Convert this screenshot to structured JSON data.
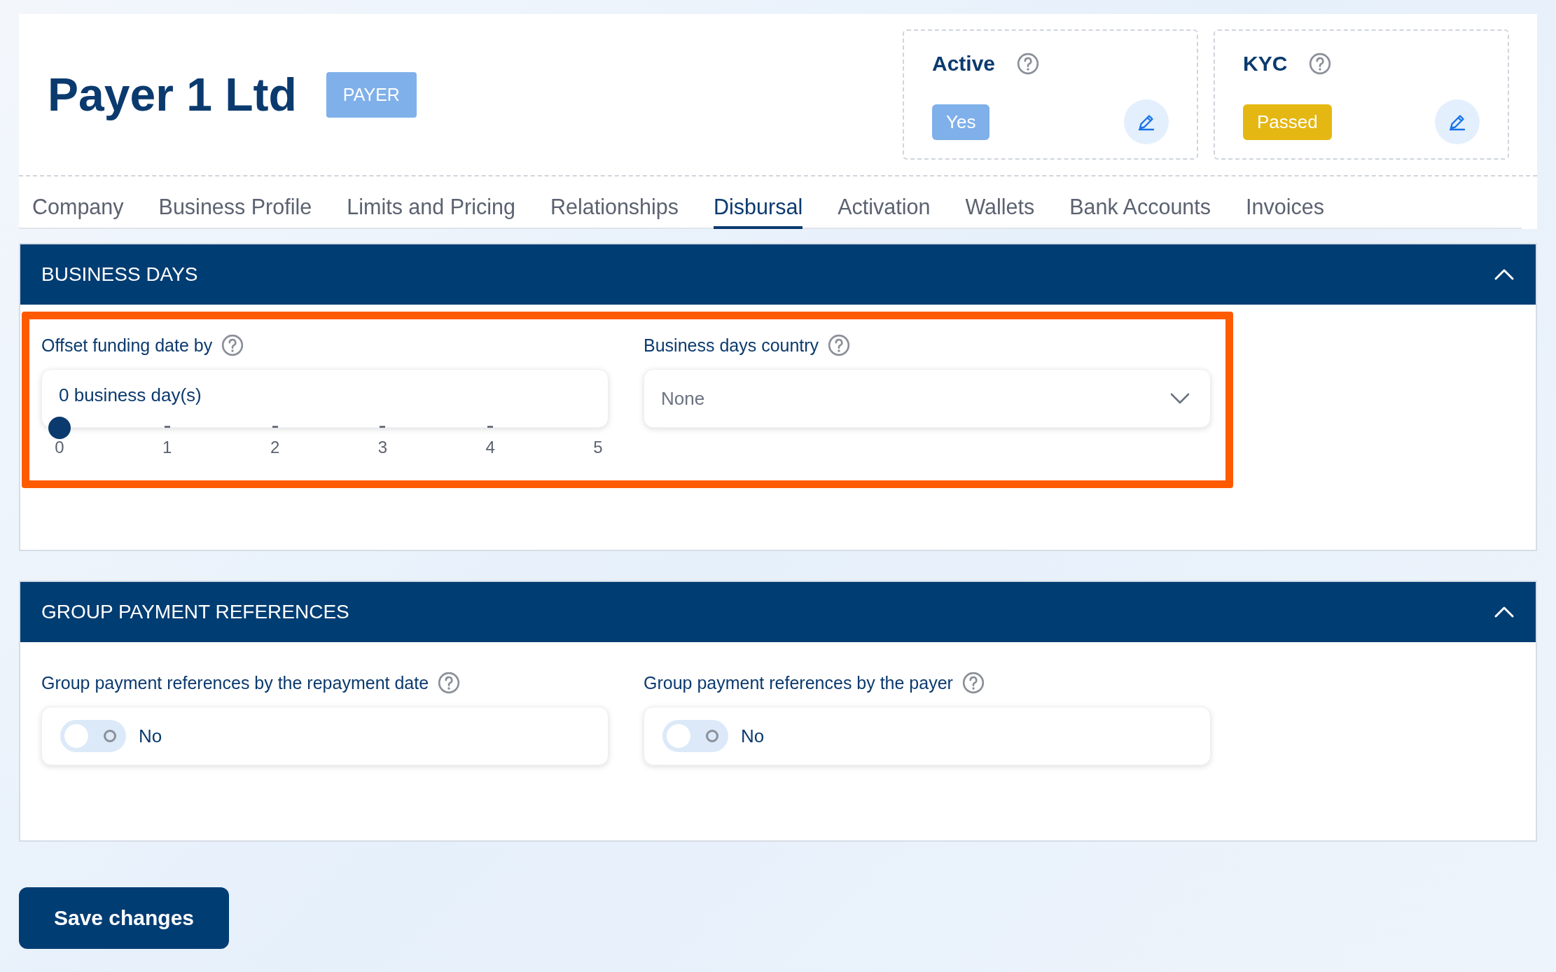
{
  "header": {
    "title": "Payer 1 Ltd",
    "badge": "PAYER",
    "status_cards": [
      {
        "label": "Active",
        "value": "Yes",
        "color": "#7fb0ea"
      },
      {
        "label": "KYC",
        "value": "Passed",
        "color": "#e5b712"
      }
    ]
  },
  "tabs": [
    {
      "label": "Company",
      "selected": false
    },
    {
      "label": "Business Profile",
      "selected": false
    },
    {
      "label": "Limits and Pricing",
      "selected": false
    },
    {
      "label": "Relationships",
      "selected": false
    },
    {
      "label": "Disbursal",
      "selected": true
    },
    {
      "label": "Activation",
      "selected": false
    },
    {
      "label": "Wallets",
      "selected": false
    },
    {
      "label": "Bank Accounts",
      "selected": false
    },
    {
      "label": "Invoices",
      "selected": false
    }
  ],
  "sections": [
    {
      "title": "BUSINESS DAYS",
      "expanded": true,
      "highlighted": true,
      "fields": [
        {
          "kind": "slider",
          "label": "Offset funding date by",
          "value": "0 business day(s)",
          "level": 0,
          "ticks": [
            "0",
            "1",
            "2",
            "3",
            "4",
            "5"
          ]
        },
        {
          "kind": "select",
          "label": "Business days country",
          "value": "None"
        }
      ]
    },
    {
      "title": "GROUP PAYMENT REFERENCES",
      "expanded": true,
      "highlighted": false,
      "fields": [
        {
          "kind": "toggle",
          "label": "Group payment references by the repayment date",
          "on": false,
          "value": "No"
        },
        {
          "kind": "toggle",
          "label": "Group payment references by the payer",
          "on": false,
          "value": "No"
        }
      ]
    }
  ],
  "save_button": "Save changes"
}
